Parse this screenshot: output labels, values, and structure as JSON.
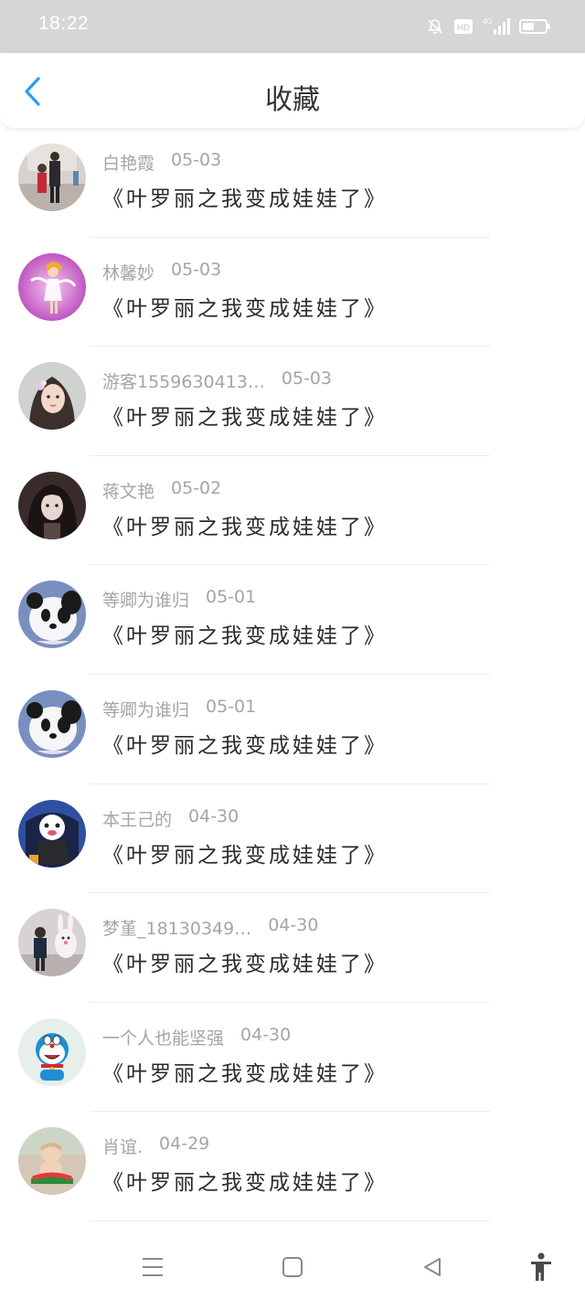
{
  "status_bar": {
    "time": "18:22",
    "icons": [
      "mute-icon",
      "hd-icon",
      "4g-signal-icon",
      "battery-icon"
    ]
  },
  "header": {
    "title": "收藏",
    "back_icon": "chevron-left-icon",
    "accent": "#2a9df4"
  },
  "items": [
    {
      "name": "白艳霞",
      "date": "05-03",
      "title": "《叶罗丽之我变成娃娃了》",
      "avatar": "photo-family"
    },
    {
      "name": "林馨妙",
      "date": "05-03",
      "title": "《叶罗丽之我变成娃娃了》",
      "avatar": "anime-fairy"
    },
    {
      "name": "游客1559630413…",
      "date": "05-03",
      "title": "《叶罗丽之我变成娃娃了》",
      "avatar": "photo-girl"
    },
    {
      "name": "蒋文艳",
      "date": "05-02",
      "title": "《叶罗丽之我变成娃娃了》",
      "avatar": "photo-dark"
    },
    {
      "name": "等卿为谁归",
      "date": "05-01",
      "title": "《叶罗丽之我变成娃娃了》",
      "avatar": "panda"
    },
    {
      "name": "等卿为谁归",
      "date": "05-01",
      "title": "《叶罗丽之我变成娃娃了》",
      "avatar": "panda"
    },
    {
      "name": "本王己的",
      "date": "04-30",
      "title": "《叶罗丽之我变成娃娃了》",
      "avatar": "cartoon-throne"
    },
    {
      "name": "梦堇_18130349…",
      "date": "04-30",
      "title": "《叶罗丽之我变成娃娃了》",
      "avatar": "photo-child-bunny"
    },
    {
      "name": "一个人也能坚强",
      "date": "04-30",
      "title": "《叶罗丽之我变成娃娃了》",
      "avatar": "doraemon"
    },
    {
      "name": "肖谊.",
      "date": "04-29",
      "title": "《叶罗丽之我变成娃娃了》",
      "avatar": "photo-baby-watermelon"
    }
  ],
  "nav_bar": {
    "icons": [
      "menu-icon",
      "home-square-icon",
      "back-triangle-icon",
      "accessibility-icon"
    ]
  }
}
